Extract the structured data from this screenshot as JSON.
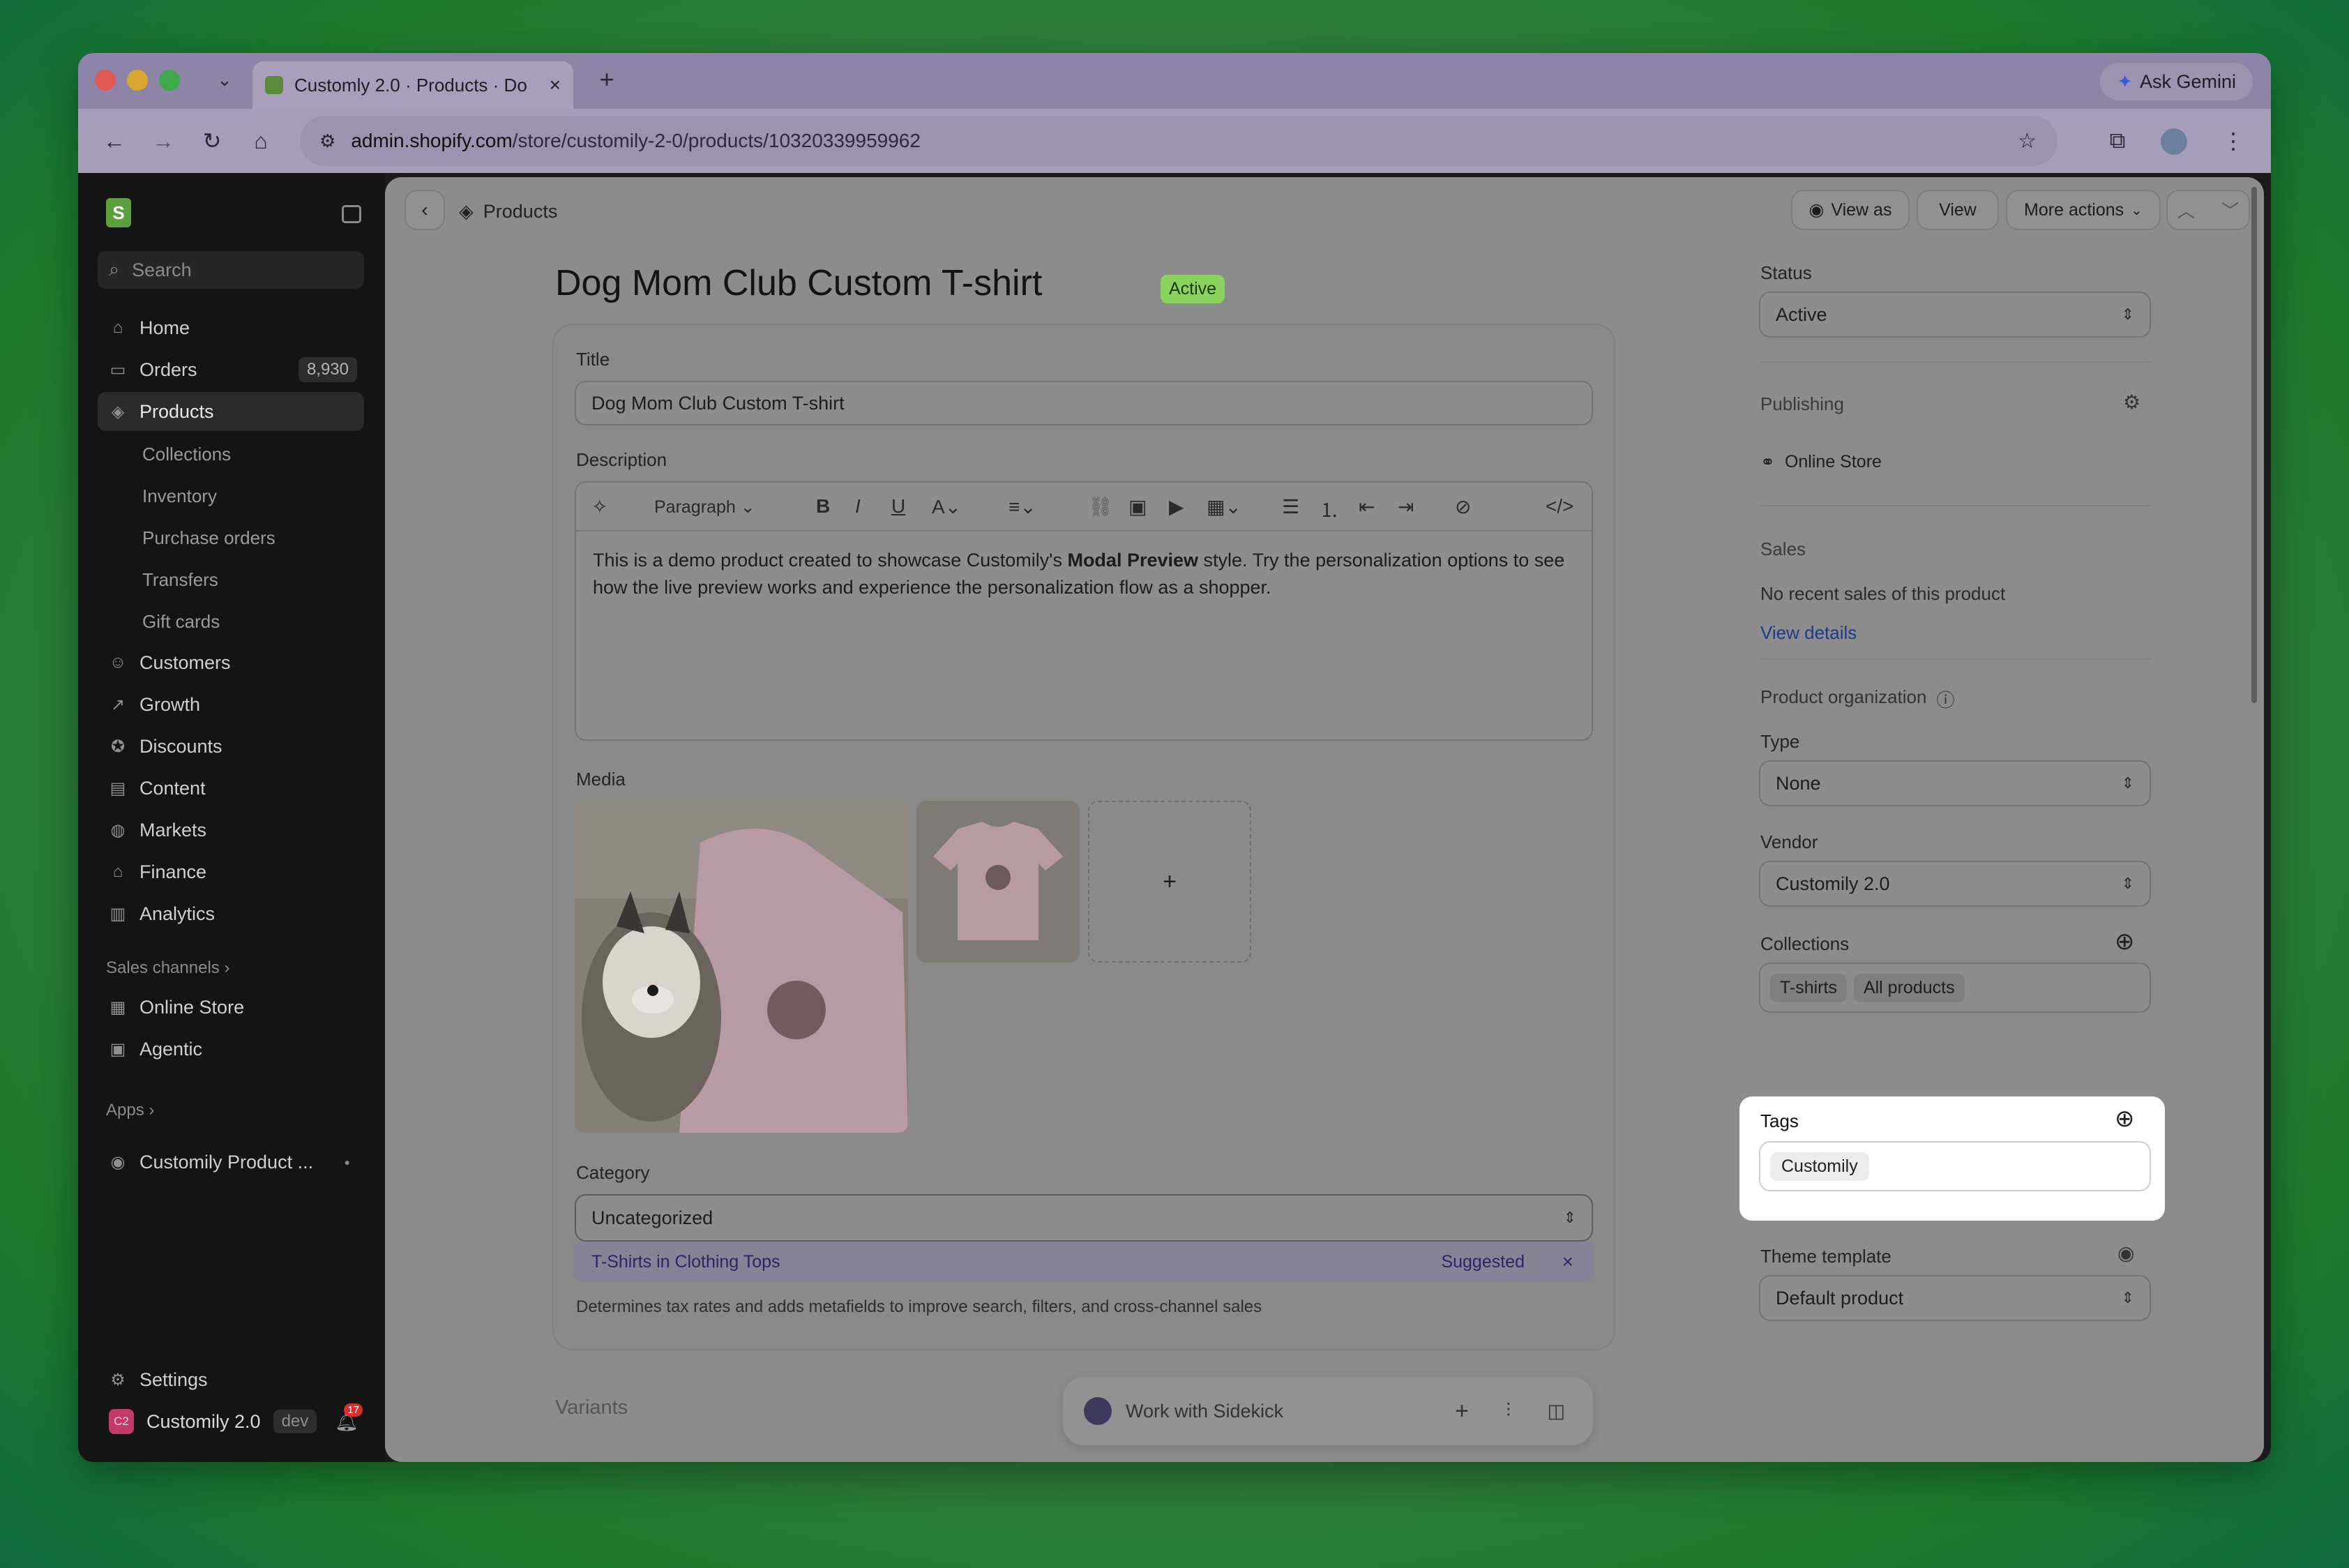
{
  "browser": {
    "tab_title": "Customly 2.0 · Products · Do",
    "url_host": "admin.shopify.com",
    "url_path": "/store/customily-2-0/products/10320339959962",
    "gemini_label": "Ask Gemini"
  },
  "sidebar": {
    "search_placeholder": "Search",
    "items": [
      {
        "label": "Home",
        "icon": "home-icon"
      },
      {
        "label": "Orders",
        "badge": "8,930",
        "icon": "orders-icon"
      },
      {
        "label": "Products",
        "icon": "tag-icon"
      },
      {
        "label": "Customers",
        "icon": "person-icon"
      },
      {
        "label": "Growth",
        "icon": "growth-icon"
      },
      {
        "label": "Discounts",
        "icon": "discount-icon"
      },
      {
        "label": "Content",
        "icon": "content-icon"
      },
      {
        "label": "Markets",
        "icon": "globe-icon"
      },
      {
        "label": "Finance",
        "icon": "bank-icon"
      },
      {
        "label": "Analytics",
        "icon": "chart-icon"
      }
    ],
    "sub_items": [
      "Collections",
      "Inventory",
      "Purchase orders",
      "Transfers",
      "Gift cards"
    ],
    "sales_channels_label": "Sales channels",
    "channels": [
      "Online Store",
      "Agentic"
    ],
    "apps_label": "Apps",
    "app_item": "Customily Product ...",
    "settings_label": "Settings",
    "store_name": "Customily 2.0",
    "store_initials": "C2",
    "store_badge": "dev",
    "notif_count": "17"
  },
  "header": {
    "breadcrumb": "Products",
    "view_as": "View as",
    "view": "View",
    "more_actions": "More actions"
  },
  "product": {
    "title": "Dog Mom Club Custom T-shirt",
    "status_badge": "Active"
  },
  "form": {
    "title_label": "Title",
    "title_value": "Dog Mom Club Custom T-shirt",
    "description_label": "Description",
    "paragraph_label": "Paragraph",
    "desc_part1": "This is a demo product created to showcase Customily's ",
    "desc_bold": "Modal Preview",
    "desc_part2": " style. Try the personalization options to see how the live preview works and experience the personalization flow as a shopper.",
    "media_label": "Media",
    "add_media": "+",
    "category_label": "Category",
    "category_value": "Uncategorized",
    "suggest_main": "T-Shirts",
    "suggest_in": " in ",
    "suggest_rest": "Clothing Tops",
    "suggested_label": "Suggested",
    "dismiss": "×",
    "category_help": "Determines tax rates and adds metafields to improve search, filters, and cross-channel sales",
    "variants_label": "Variants"
  },
  "right": {
    "status_label": "Status",
    "status_value": "Active",
    "publishing_label": "Publishing",
    "online_store": "Online Store",
    "sales_label": "Sales",
    "sales_text": "No recent sales of this product",
    "view_details": "View details",
    "org_label": "Product organization",
    "type_label": "Type",
    "type_value": "None",
    "vendor_label": "Vendor",
    "vendor_value": "Customily 2.0",
    "collections_label": "Collections",
    "collections": [
      "T-shirts",
      "All products"
    ],
    "tags_label": "Tags",
    "tags": [
      "Customily"
    ],
    "theme_label": "Theme template",
    "theme_value": "Default product"
  },
  "sidekick": {
    "label": "Work with Sidekick"
  },
  "colors": {
    "accent": "#4a56d1",
    "active_badge": "#8bd35f",
    "highlight": "#ffffff"
  }
}
